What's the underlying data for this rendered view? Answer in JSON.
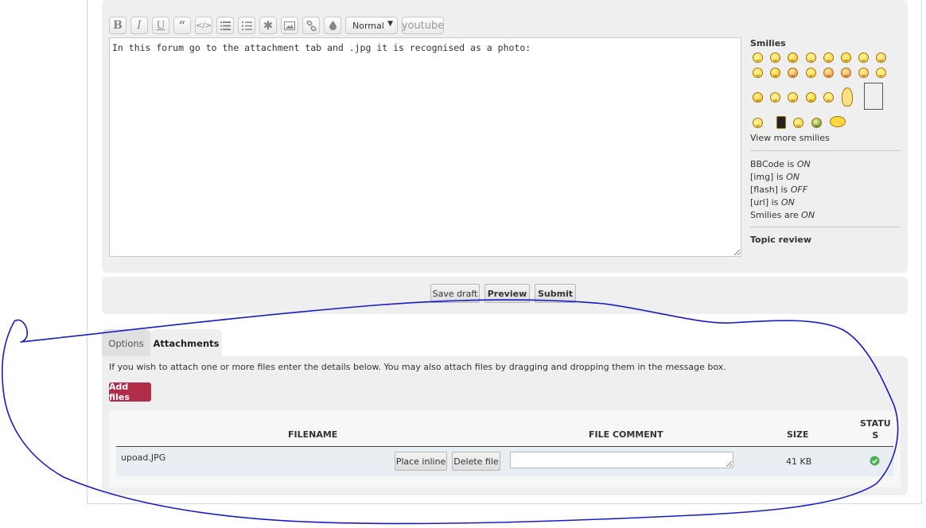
{
  "toolbar": {
    "buttons": [
      "bold",
      "italic",
      "underline",
      "quote",
      "code",
      "list",
      "list-numbered",
      "list-item",
      "image",
      "url",
      "color"
    ],
    "font_size": "Normal",
    "extra_label": "youtube"
  },
  "editor": {
    "message": "In this forum go to the attachment tab and .jpg it is recognised as a photo:"
  },
  "sidebar": {
    "smilies_title": "Smilies",
    "view_more": "View more smilies",
    "options": [
      {
        "label": "BBCode is ",
        "value": "ON"
      },
      {
        "label": "[img] is ",
        "value": "ON"
      },
      {
        "label": "[flash] is ",
        "value": "OFF"
      },
      {
        "label": "[url] is ",
        "value": "ON"
      },
      {
        "label": "Smilies are ",
        "value": "ON"
      }
    ],
    "topic_review": "Topic review"
  },
  "actions": {
    "save_draft": "Save draft",
    "preview": "Preview",
    "submit": "Submit"
  },
  "tabs": {
    "options": "Options",
    "attachments": "Attachments"
  },
  "attachments": {
    "instructions": "If you wish to attach one or more files enter the details below. You may also attach files by dragging and dropping them in the message box.",
    "add_files": "Add files",
    "headers": {
      "filename": "FILENAME",
      "comment": "FILE COMMENT",
      "size": "SIZE",
      "status_line1": "STATU",
      "status_line2": "S"
    },
    "files": [
      {
        "name": "upoad.JPG",
        "place_inline": "Place inline",
        "delete": "Delete file",
        "comment": "",
        "size": "41 KB",
        "status": "ok"
      }
    ]
  },
  "colors": {
    "accent_add_files": "#b02c49",
    "annotation": "#1a1ac8",
    "status_ok": "#4caf50"
  }
}
